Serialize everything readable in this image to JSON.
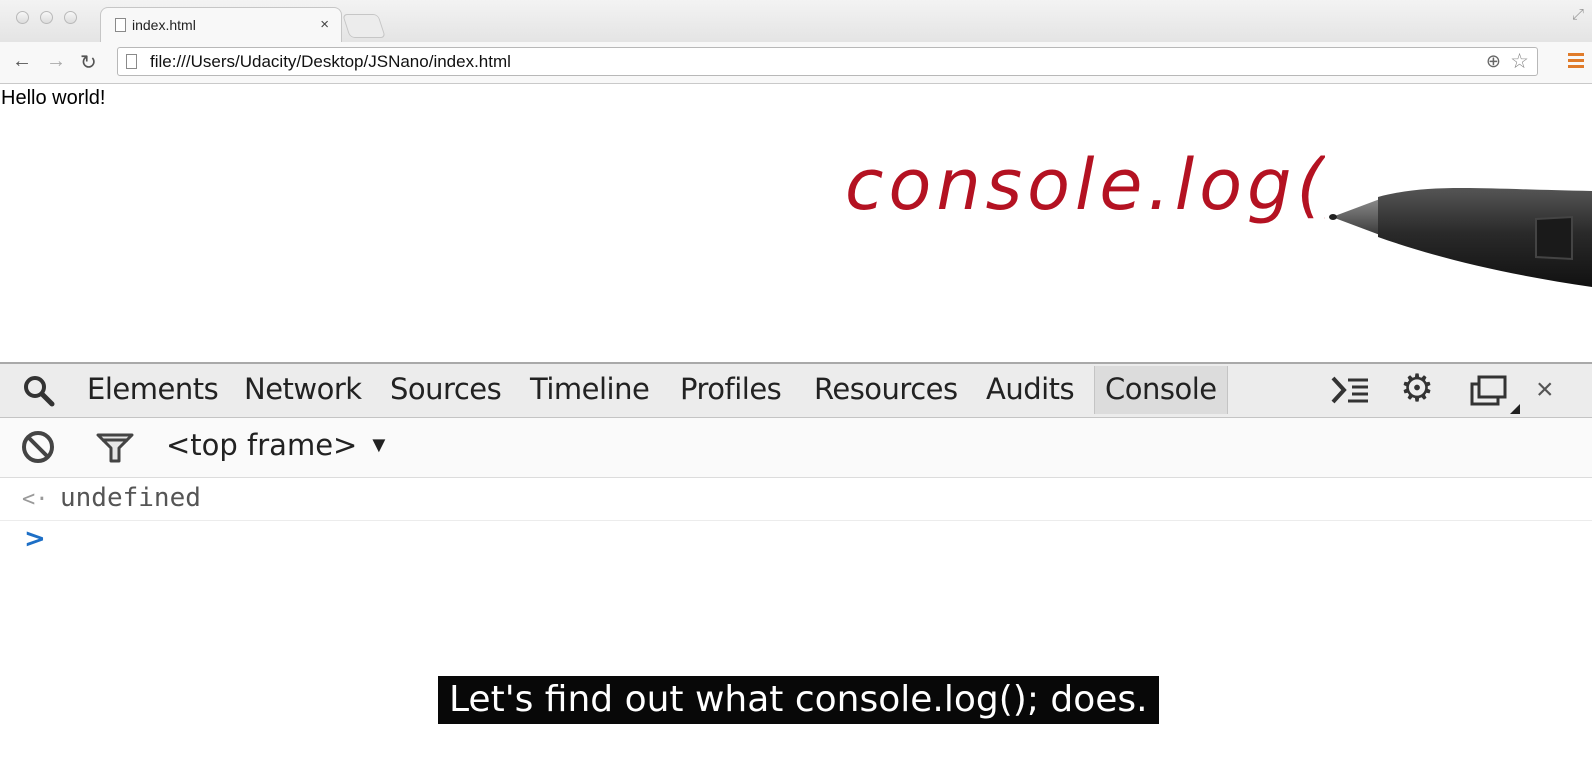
{
  "browser": {
    "tab_title": "index.html",
    "tab_close": "×",
    "url": "file:///Users/Udacity/Desktop/JSNano/index.html",
    "nav": {
      "back": "←",
      "forward": "→",
      "reload": "↻"
    },
    "omnibox_icons": {
      "zoom": "⊕",
      "star": "☆"
    },
    "menu_color": "#e07b2a"
  },
  "page": {
    "body_text": "Hello world!",
    "handwriting": "console.log();",
    "handwriting_color": "#b41222"
  },
  "devtools": {
    "tabs": [
      {
        "label": "Elements"
      },
      {
        "label": "Network"
      },
      {
        "label": "Sources"
      },
      {
        "label": "Timeline"
      },
      {
        "label": "Profiles"
      },
      {
        "label": "Resources"
      },
      {
        "label": "Audits"
      },
      {
        "label": "Console",
        "active": true
      }
    ],
    "close": "×",
    "frame_selector": "<top frame>",
    "frame_arrow": "▼",
    "console": {
      "result_marker": "<·",
      "result_value": "undefined",
      "prompt": ">"
    },
    "prompt_color": "#1d6fc6"
  },
  "caption": "Let's find out what console.log(); does."
}
